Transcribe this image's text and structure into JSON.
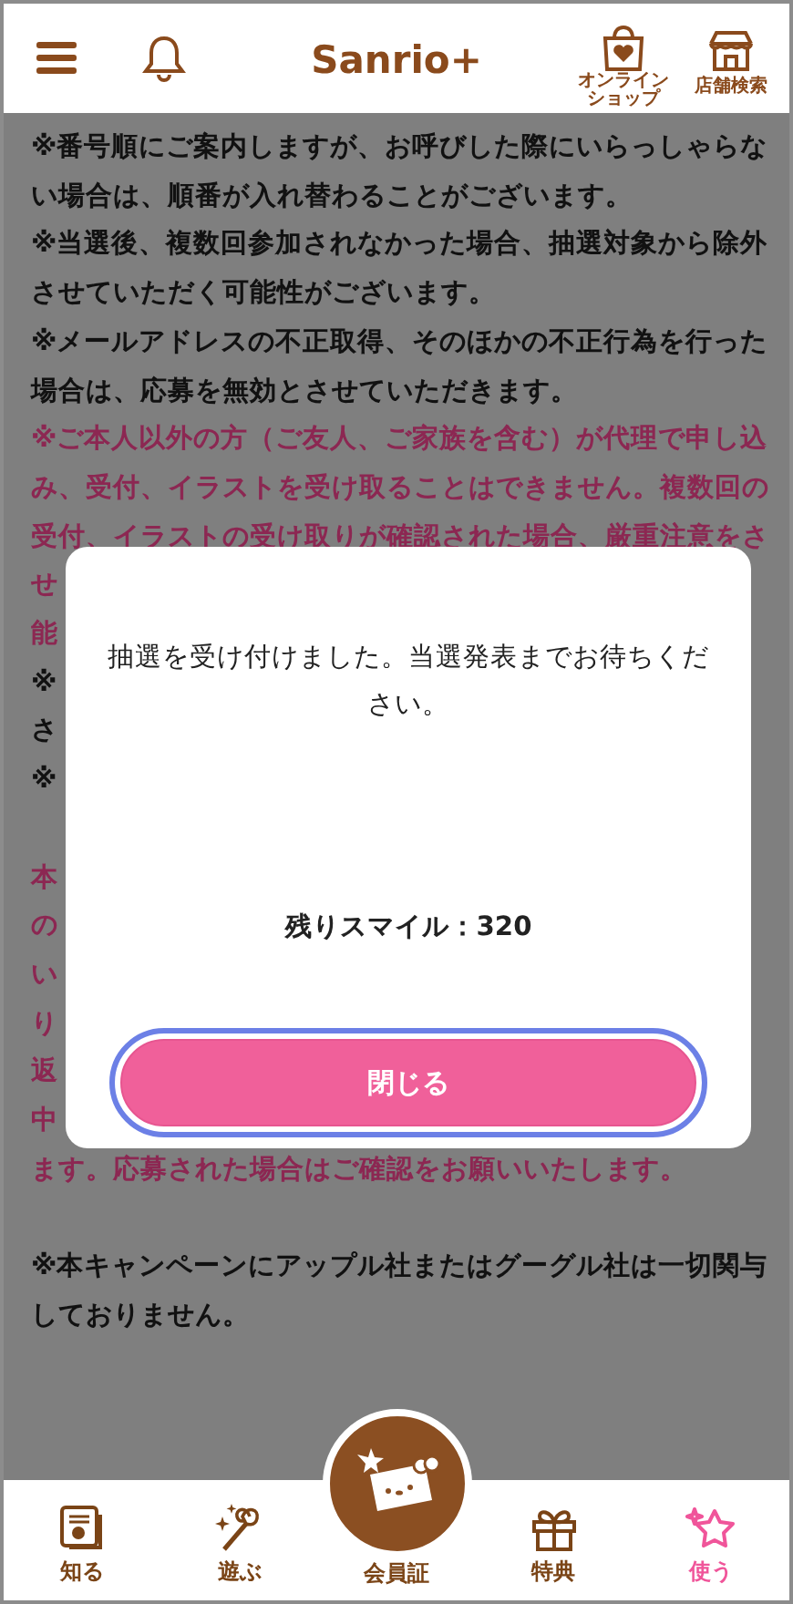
{
  "header": {
    "logo": "Sanrio+",
    "shop_label": "オンラインショップ",
    "store_label": "店舗検索"
  },
  "sections": [
    [
      {
        "text": "※番号順にご案内しますが、お呼びした際にいらっしゃらな",
        "kind": "note"
      },
      {
        "text": "い場合は、順番が入れ替わることがございます。",
        "kind": "note"
      },
      {
        "text": "※当選後、複数回参加されなかった場合、抽選対象から除外",
        "kind": "note"
      },
      {
        "text": "させていただく可能性がございます。",
        "kind": "note"
      },
      {
        "text": "※メールアドレスの不正取得、そのほかの不正行為を行った",
        "kind": "note"
      },
      {
        "text": "場合は、応募を無効とさせていただきます。",
        "kind": "note"
      },
      {
        "text": "※ご本人以外の方（ご友人、ご家族を含む）が代理で申し込",
        "kind": "warning"
      },
      {
        "text": "み、受付、イラストを受け取ることはできません。複数回の",
        "kind": "warning"
      },
      {
        "text": "受付、イラストの受け取りが確認された場合、厳重注意をさ",
        "kind": "warning"
      },
      {
        "text": "せ",
        "kind": "warning"
      },
      {
        "text": "能",
        "kind": "warning"
      },
      {
        "text": "※",
        "kind": "note"
      },
      {
        "text": "さ",
        "kind": "note"
      },
      {
        "text": "※",
        "kind": "note"
      }
    ],
    [
      {
        "text": "本",
        "kind": "warning"
      },
      {
        "text": "の",
        "kind": "warning"
      },
      {
        "text": "い",
        "kind": "warning"
      },
      {
        "text": "り",
        "kind": "warning"
      },
      {
        "text": "返",
        "kind": "warning"
      },
      {
        "text": "中",
        "kind": "warning"
      },
      {
        "text": "ます。応募された場合はご確認をお願いいたします。",
        "kind": "warning"
      }
    ],
    [
      {
        "text": "※本キャンペーンにアップル社またはグーグル社は一切関与",
        "kind": "note"
      },
      {
        "text": "しておりません。",
        "kind": "note"
      }
    ]
  ],
  "dialog": {
    "message": "抽選を受け付けました。当選発表までお待ちください。",
    "balance": "残りスマイル：320",
    "button": {
      "label": "閉じる",
      "focused": true
    }
  },
  "tabbar": [
    {
      "label": "知る",
      "kind": "normal",
      "selected": false
    },
    {
      "label": "遊ぶ",
      "kind": "normal",
      "selected": false
    },
    {
      "label": "会員証",
      "kind": "center",
      "selected": false
    },
    {
      "label": "特典",
      "kind": "normal",
      "selected": false
    },
    {
      "label": "使う",
      "kind": "normal",
      "selected": true
    }
  ]
}
